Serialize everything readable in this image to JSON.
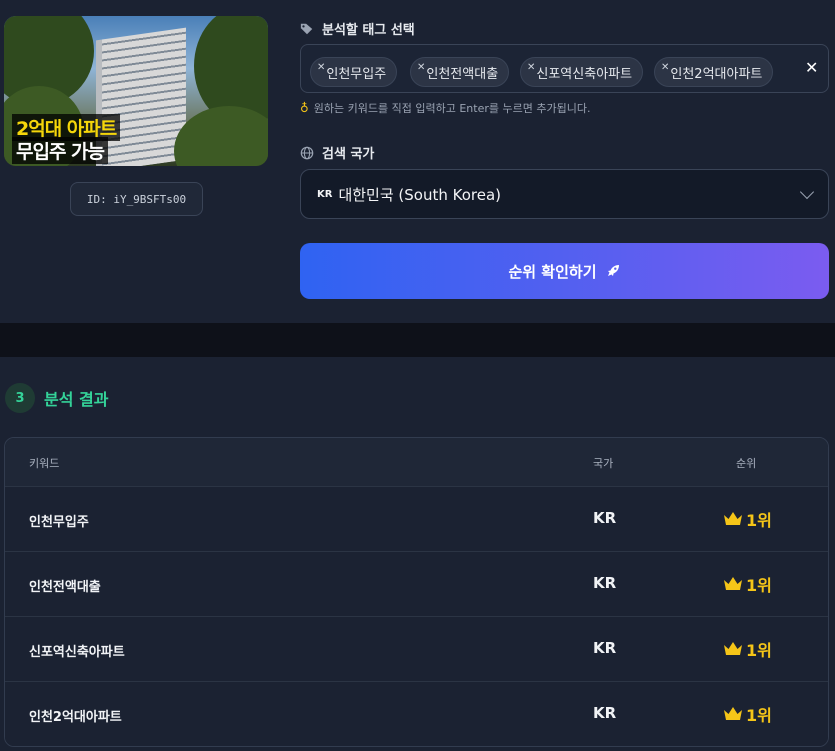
{
  "thumbnail": {
    "caption_line1": "2억대 아파트",
    "caption_line2": "무입주 가능"
  },
  "video_id": "ID: iY_9BSFTs00",
  "tag_section": {
    "label": "분석할 태그 선택",
    "tags": [
      "인천무입주",
      "인천전액대출",
      "신포역신축아파트",
      "인천2억대아파트"
    ],
    "hint": "원하는 키워드를 직접 입력하고 Enter를 누르면 추가됩니다."
  },
  "country_section": {
    "label": "검색 국가",
    "selected_code": "KR",
    "selected_value": "대한민국 (South Korea)"
  },
  "check_button": {
    "label": "순위 확인하기"
  },
  "results": {
    "step_number": "3",
    "title": "분석 결과",
    "headers": {
      "keyword": "키워드",
      "country": "국가",
      "rank": "순위"
    },
    "rows": [
      {
        "keyword": "인천무입주",
        "country": "KR",
        "rank": "1위"
      },
      {
        "keyword": "인천전액대출",
        "country": "KR",
        "rank": "1위"
      },
      {
        "keyword": "신포역신축아파트",
        "country": "KR",
        "rank": "1위"
      },
      {
        "keyword": "인천2억대아파트",
        "country": "KR",
        "rank": "1위"
      }
    ]
  },
  "colors": {
    "accent_green": "#34d399",
    "rank_gold": "#f5c518",
    "button_start": "#2f63f2",
    "button_end": "#7b5cf0"
  }
}
